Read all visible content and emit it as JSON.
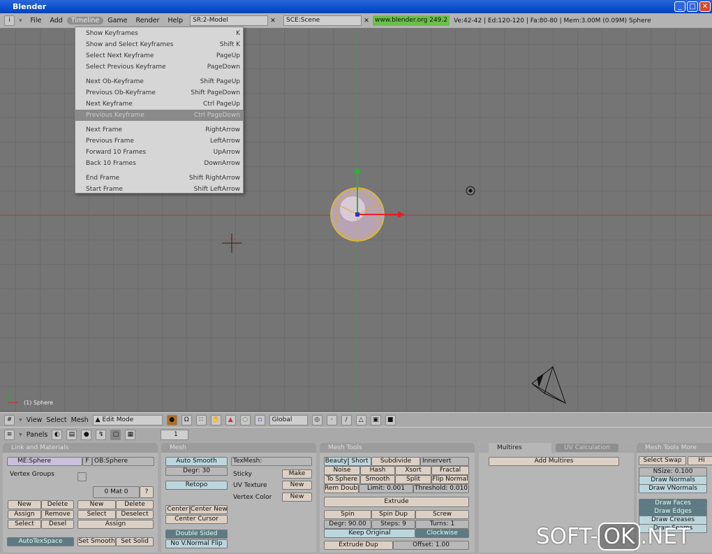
{
  "window": {
    "title": "Blender",
    "min": "_",
    "max": "□",
    "close": "✕"
  },
  "topbar": {
    "menus": [
      "File",
      "Add",
      "Timeline",
      "Game",
      "Render",
      "Help"
    ],
    "screen": "SR:2-Model",
    "scene": "SCE:Scene",
    "version": "www.blender.org 249.2",
    "stats": "Ve:42-42 | Ed:120-120 | Fa:80-80 | Mem:3.00M (0.09M) Sphere"
  },
  "timeline_menu": [
    [
      {
        "l": "Show Keyframes",
        "k": "K"
      },
      {
        "l": "Show and Select Keyframes",
        "k": "Shift K"
      },
      {
        "l": "Select Next Keyframe",
        "k": "PageUp"
      },
      {
        "l": "Select Previous Keyframe",
        "k": "PageDown"
      }
    ],
    [
      {
        "l": "Next Ob-Keyframe",
        "k": "Shift PageUp"
      },
      {
        "l": "Previous Ob-Keyframe",
        "k": "Shift PageDown"
      },
      {
        "l": "Next Keyframe",
        "k": "Ctrl PageUp"
      },
      {
        "l": "Previous Keyframe",
        "k": "Ctrl PageDown"
      }
    ],
    [
      {
        "l": "Next Frame",
        "k": "RightArrow"
      },
      {
        "l": "Previous Frame",
        "k": "LeftArrow"
      },
      {
        "l": "Forward 10 Frames",
        "k": "UpArrow"
      },
      {
        "l": "Back 10 Frames",
        "k": "DownArrow"
      }
    ],
    [
      {
        "l": "End Frame",
        "k": "Shift RightArrow"
      },
      {
        "l": "Start Frame",
        "k": "Shift LeftArrow"
      }
    ]
  ],
  "viewport": {
    "object_label": "(1) Sphere"
  },
  "view3d_header": {
    "menus": [
      "View",
      "Select",
      "Mesh"
    ],
    "mode": "Edit Mode",
    "orientation": "Global"
  },
  "buttons_header": {
    "label": "Panels",
    "frame": "1"
  },
  "panels": {
    "link": {
      "title": "Link and Materials",
      "mesh": "ME:Sphere",
      "f": "F",
      "ob": "OB:Sphere",
      "vgroups": "Vertex Groups",
      "mat": "0 Mat 0",
      "q": "?",
      "new": "New",
      "delete": "Delete",
      "assign": "Assign",
      "remove": "Remove",
      "select": "Select",
      "desel": "Desel",
      "deselect": "Deselect",
      "autotex": "AutoTexSpace",
      "smooth": "Set Smooth",
      "solid": "Set Solid"
    },
    "mesh": {
      "title": "Mesh",
      "autosmooth": "Auto Smooth",
      "degr": "Degr: 30",
      "retopo": "Retopo",
      "center": "Center",
      "center_new": "Center New",
      "center_cursor": "Center Cursor",
      "double": "Double Sided",
      "noflip": "No V.Normal Flip",
      "texmesh": "TexMesh:",
      "sticky": "Sticky",
      "make": "Make",
      "uvtex": "UV Texture",
      "new": "New",
      "vcol": "Vertex Color"
    },
    "tools": {
      "title": "Mesh Tools",
      "beauty": "Beauty",
      "short": "Short",
      "subdivide": "Subdivide",
      "innervert": "Innervert",
      "noise": "Noise",
      "hash": "Hash",
      "xsort": "Xsort",
      "fractal": "Fractal",
      "tosphere": "To Sphere",
      "smooth": "Smooth",
      "split": "Split",
      "flip": "Flip Normal",
      "remdoubl": "Rem Doubl",
      "limit": "Limit: 0.001",
      "threshold": "Threshold: 0.010",
      "extrude": "Extrude",
      "spin": "Spin",
      "spindup": "Spin Dup",
      "screw": "Screw",
      "degr": "Degr: 90.00",
      "steps": "Steps: 9",
      "turns": "Turns: 1",
      "keep": "Keep Original",
      "clockwise": "Clockwise",
      "extdup": "Extrude Dup",
      "offset": "Offset: 1.00"
    },
    "multires": {
      "tab1": "Multires",
      "tab2": "UV Calculation",
      "add": "Add Multires"
    },
    "more": {
      "title": "Mesh Tools More",
      "swap": "Select Swap",
      "hi": "Hi",
      "nsize": "NSize: 0.100",
      "normals": "Draw Normals",
      "vnormals": "Draw VNormals",
      "faces": "Draw Faces",
      "edges": "Draw Edges",
      "creases": "Draw Creases",
      "seams": "Draw Seams"
    }
  },
  "watermark": {
    "text1": "SOFT-",
    "text2": "OK",
    ".net": ".NET"
  }
}
